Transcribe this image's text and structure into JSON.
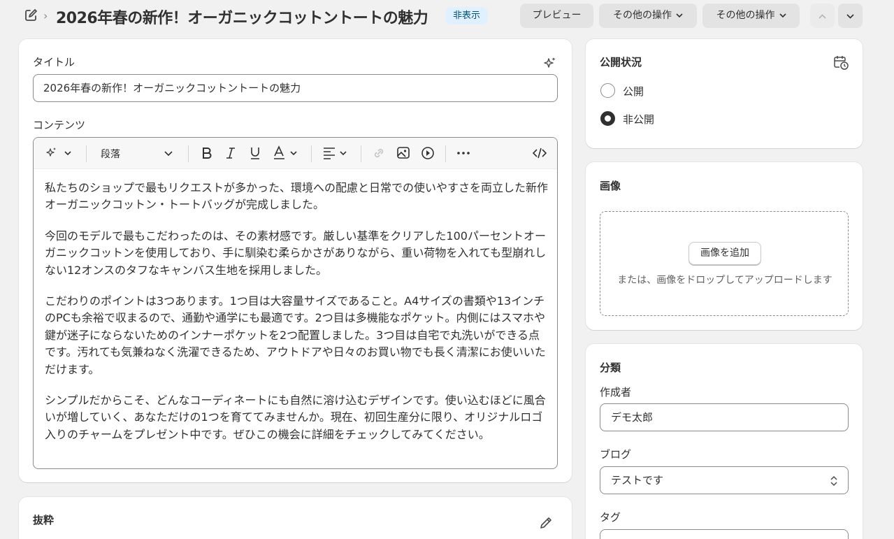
{
  "header": {
    "title": "2026年春の新作！オーガニックコットントートの魅力",
    "badge": "非表示",
    "preview_label": "プレビュー",
    "more_actions_1": "その他の操作",
    "more_actions_2": "その他の操作"
  },
  "main": {
    "title_label": "タイトル",
    "title_value": "2026年春の新作！オーガニックコットントートの魅力",
    "content_label": "コンテンツ",
    "toolbar": {
      "paragraph_label": "段落"
    },
    "paragraphs": [
      "私たちのショップで最もリクエストが多かった、環境への配慮と日常での使いやすさを両立した新作オーガニックコットン・トートバッグが完成しました。",
      "今回のモデルで最もこだわったのは、その素材感です。厳しい基準をクリアした100パーセントオーガニックコットンを使用しており、手に馴染む柔らかさがありながら、重い荷物を入れても型崩れしない12オンスのタフなキャンバス生地を採用しました。",
      "こだわりのポイントは3つあります。1つ目は大容量サイズであること。A4サイズの書類や13インチのPCも余裕で収まるので、通勤や通学にも最適です。2つ目は多機能なポケット。内側にはスマホや鍵が迷子にならないためのインナーポケットを2つ配置しました。3つ目は自宅で丸洗いができる点です。汚れても気兼ねなく洗濯できるため、アウトドアや日々のお買い物でも長く清潔にお使いいただけます。",
      "シンプルだからこそ、どんなコーディネートにも自然に溶け込むデザインです。使い込むほどに風合いが増していく、あなただけの1つを育ててみませんか。現在、初回生産分に限り、オリジナルロゴ入りのチャームをプレゼント中です。ぜひこの機会に詳細をチェックしてみてください。"
    ]
  },
  "excerpt": {
    "title": "抜粋"
  },
  "visibility": {
    "title": "公開状況",
    "options": [
      "公開",
      "非公開"
    ],
    "selected": "非公開"
  },
  "image": {
    "title": "画像",
    "add_button": "画像を追加",
    "drop_hint": "または、画像をドロップしてアップロードします"
  },
  "category": {
    "title": "分類",
    "author_label": "作成者",
    "author_value": "デモ太郎",
    "blog_label": "ブログ",
    "blog_value": "テストです",
    "tags_label": "タグ"
  },
  "colors": {
    "badge_bg": "#e0f0ff",
    "badge_text": "#00527c",
    "page_bg": "#f1f1f1"
  }
}
